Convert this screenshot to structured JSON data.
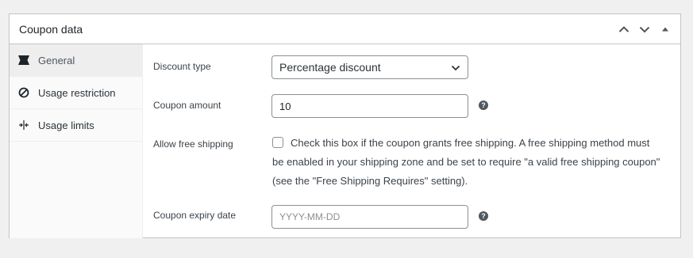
{
  "panel": {
    "title": "Coupon data",
    "controls": [
      "chevron-up",
      "chevron-down",
      "collapse-triangle"
    ]
  },
  "tabs": [
    {
      "label": "General",
      "icon": "ticket-icon",
      "active": true
    },
    {
      "label": "Usage restriction",
      "icon": "block-icon",
      "active": false
    },
    {
      "label": "Usage limits",
      "icon": "limits-icon",
      "active": false
    }
  ],
  "fields": {
    "discount_type": {
      "label": "Discount type",
      "value": "Percentage discount"
    },
    "coupon_amount": {
      "label": "Coupon amount",
      "value": "10"
    },
    "free_shipping": {
      "label": "Allow free shipping",
      "checked": false,
      "desc_line1": "Check this box if the coupon grants free shipping. A free shipping method must",
      "desc_line2": "be enabled in your shipping zone and be set to require \"a valid free shipping coupon\"",
      "desc_line3": "(see the \"Free Shipping Requires\" setting)."
    },
    "expiry_date": {
      "label": "Coupon expiry date",
      "placeholder": "YYYY-MM-DD"
    }
  },
  "colors": {
    "border": "#c3c4c7",
    "text": "#1d2327",
    "help_icon": "#50575e",
    "sidebar_active": "#eeeeee"
  }
}
